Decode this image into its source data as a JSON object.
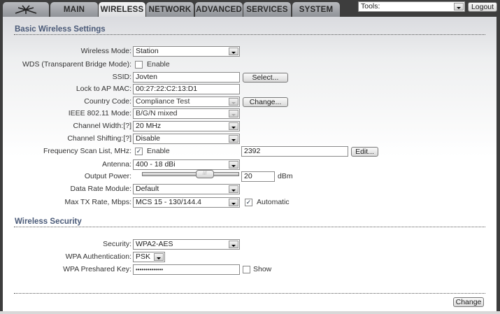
{
  "tabs": [
    {
      "label": "MAIN"
    },
    {
      "label": "WIRELESS"
    },
    {
      "label": "NETWORK"
    },
    {
      "label": "ADVANCED"
    },
    {
      "label": "SERVICES"
    },
    {
      "label": "SYSTEM"
    }
  ],
  "active_tab": "WIRELESS",
  "tools": {
    "value": "Tools:"
  },
  "logout_label": "Logout",
  "basic": {
    "title": "Basic Wireless Settings",
    "wireless_mode": {
      "label": "Wireless Mode:",
      "value": "Station"
    },
    "wds": {
      "label": "WDS (Transparent Bridge Mode):",
      "checkbox_label": "Enable",
      "checked": false
    },
    "ssid": {
      "label": "SSID:",
      "value": "Jovten",
      "button": "Select..."
    },
    "lock_mac": {
      "label": "Lock to AP MAC:",
      "value": "00:27:22:C2:13:D1"
    },
    "country": {
      "label": "Country Code:",
      "value": "Compliance Test",
      "button": "Change..."
    },
    "ieee_mode": {
      "label": "IEEE 802.11 Mode:",
      "value": "B/G/N mixed"
    },
    "channel_width": {
      "label": "Channel Width:[?]",
      "value": "20 MHz"
    },
    "channel_shifting": {
      "label": "Channel Shifting:[?]",
      "value": "Disable"
    },
    "freq_scan": {
      "label": "Frequency Scan List, MHz:",
      "checkbox_label": "Enable",
      "checked": true,
      "value": "2392",
      "button": "Edit..."
    },
    "antenna": {
      "label": "Antenna:",
      "value": "400 - 18 dBi"
    },
    "output_power": {
      "label": "Output Power:",
      "value": "20",
      "unit": "dBm",
      "slider_fraction": 0.68
    },
    "data_rate": {
      "label": "Data Rate Module:",
      "value": "Default"
    },
    "max_tx": {
      "label": "Max TX Rate, Mbps:",
      "value": "MCS 15 - 130/144.4",
      "checkbox_label": "Automatic",
      "checked": true
    }
  },
  "security": {
    "title": "Wireless Security",
    "security": {
      "label": "Security:",
      "value": "WPA2-AES"
    },
    "wpa_auth": {
      "label": "WPA Authentication:",
      "value": "PSK"
    },
    "wpa_key": {
      "label": "WPA Preshared Key:",
      "value": "••••••••••••••",
      "checkbox_label": "Show",
      "checked": false
    }
  },
  "change_label": "Change"
}
